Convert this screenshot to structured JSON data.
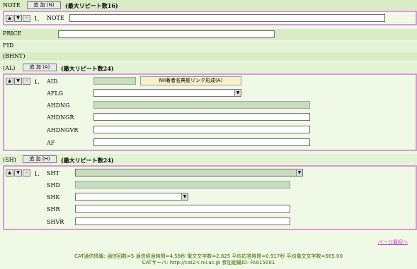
{
  "note": {
    "label": "NOTE",
    "add_button": "追 加 (N)",
    "max_repeat": "(最大リピート数16)",
    "row_index": "1.",
    "field_label": "NOTE",
    "field_value": ""
  },
  "price": {
    "label": "PRICE",
    "value": ""
  },
  "fid": {
    "label": "FID"
  },
  "bhnt": {
    "label": "(BHNT)"
  },
  "al": {
    "label": "(AL)",
    "add_button": "追 加 (A)",
    "max_repeat": "(最大リピート数24)",
    "row_index": "1.",
    "aid_label": "AID",
    "aid_value": "",
    "nii_button": "NII著者名典拠リンク形成(A)",
    "aflg_label": "AFLG",
    "aflg_value": "",
    "ahdng_label": "AHDNG",
    "ahdng_value": "",
    "ahdngr_label": "AHDNGR",
    "ahdngr_value": "",
    "ahdngvr_label": "AHDNGVR",
    "ahdngvr_value": "",
    "af_label": "AF",
    "af_value": ""
  },
  "sh": {
    "label": "(SH)",
    "add_button": "追 加 (H)",
    "max_repeat": "(最大リピート数24)",
    "row_index": "1.",
    "sht_label": "SHT",
    "sht_value": "",
    "shd_label": "SHD",
    "shd_value": "",
    "shk_label": "SHK",
    "shk_value": "",
    "shr_label": "SHR",
    "shr_value": "",
    "shvr_label": "SHVR",
    "shvr_value": ""
  },
  "controls": {
    "up": "▲",
    "down": "▼",
    "delete": "×"
  },
  "page_top_link": "ページ最初へ",
  "footer": {
    "line1": "CAT通信情報: 通信回数=5 通信経過時間=4.58秒 電文文字数=2,825 平均応答時間=0.917秒 平均電文文字数=565.00",
    "line2": "CATサーバ: http://cat2-t.nii.ac.jp 参加組織ID: FA015001"
  }
}
